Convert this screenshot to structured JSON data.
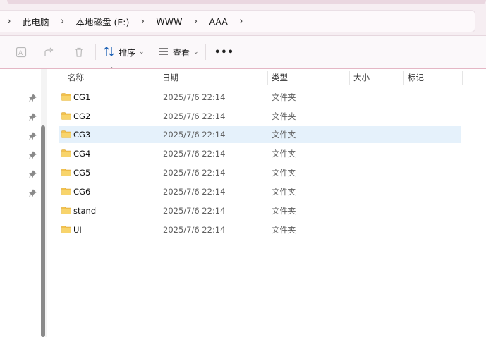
{
  "breadcrumb": [
    "此电脑",
    "本地磁盘 (E:)",
    "WWW",
    "AAA"
  ],
  "toolbar": {
    "ai_icon": "ai-rewrite-icon",
    "share_icon": "share-icon",
    "delete_icon": "trash-icon",
    "sort_label": "排序",
    "view_label": "查看",
    "more_label": "•••"
  },
  "columns": {
    "name": "名称",
    "date": "日期",
    "type": "类型",
    "size": "大小",
    "tags": "标记"
  },
  "files": [
    {
      "name": "CG1",
      "date": "2025/7/6 22:14",
      "type": "文件夹",
      "selected": false
    },
    {
      "name": "CG2",
      "date": "2025/7/6 22:14",
      "type": "文件夹",
      "selected": false
    },
    {
      "name": "CG3",
      "date": "2025/7/6 22:14",
      "type": "文件夹",
      "selected": true
    },
    {
      "name": "CG4",
      "date": "2025/7/6 22:14",
      "type": "文件夹",
      "selected": false
    },
    {
      "name": "CG5",
      "date": "2025/7/6 22:14",
      "type": "文件夹",
      "selected": false
    },
    {
      "name": "CG6",
      "date": "2025/7/6 22:14",
      "type": "文件夹",
      "selected": false
    },
    {
      "name": "stand",
      "date": "2025/7/6 22:14",
      "type": "文件夹",
      "selected": false
    },
    {
      "name": "UI",
      "date": "2025/7/6 22:14",
      "type": "文件夹",
      "selected": false
    }
  ],
  "colors": {
    "accent": "#0067c0",
    "selection": "#e5f1fb",
    "folder": "#f4c542"
  }
}
